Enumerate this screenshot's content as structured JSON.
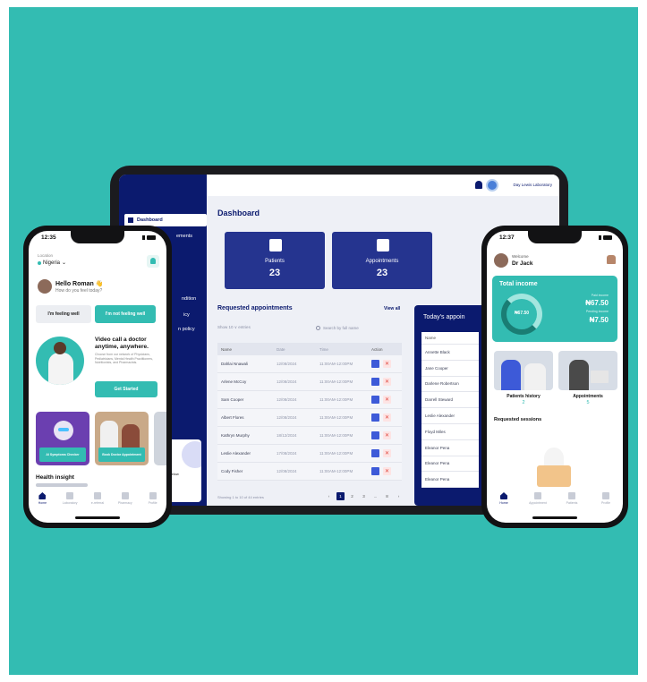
{
  "colors": {
    "background": "#33bcb2",
    "navy": "#0b1a6e",
    "teal": "#33bcb2",
    "statCard": "#25348f"
  },
  "tablet": {
    "sidebar": {
      "items": [
        {
          "label": "Dashboard",
          "icon": "grid-icon",
          "active": true
        },
        {
          "label": "ements",
          "active": false
        },
        {
          "label": "ndition",
          "active": false
        },
        {
          "label": "icy",
          "active": false
        },
        {
          "label": "n policy",
          "active": false
        }
      ],
      "promo": {
        "text": "ur fyou below",
        "button": "ill"
      }
    },
    "topbar": {
      "lab_name": "Day Lewis Laboratory"
    },
    "title": "Dashboard",
    "stats": [
      {
        "label": "Patients",
        "value": "23",
        "icon": "person-icon"
      },
      {
        "label": "Appointments",
        "value": "23",
        "icon": "calendar-icon"
      }
    ],
    "stat3_label": "To",
    "requested": {
      "title": "Requested appointments",
      "view_all": "View all",
      "show_text": "Show  10  ∨  entries",
      "search_placeholder": "Search by full name",
      "headers": [
        "Name",
        "Date",
        "Time",
        "Action"
      ],
      "rows": [
        [
          "Dahlai Nnawali",
          "12/08/2024",
          "11:00AM-12:00PM"
        ],
        [
          "Arlene McCoy",
          "12/08/2024",
          "11:00AM-12:00PM"
        ],
        [
          "Sam Cooper",
          "12/08/2024",
          "11:00AM-12:00PM"
        ],
        [
          "Albert Flores",
          "12/08/2024",
          "11:00AM-12:00PM"
        ],
        [
          "Kathryn Murphy",
          "18/12/2024",
          "11:00AM-12:00PM"
        ],
        [
          "Leslie Alexander",
          "17/08/2024",
          "11:00AM-12:00PM"
        ],
        [
          "Cody Fisher",
          "12/08/2024",
          "11:00AM-12:00PM"
        ]
      ],
      "footer": "Showing 1 to 10 of 44 entries",
      "pages": [
        "‹",
        "1",
        "2",
        "3",
        "...",
        "8",
        "›"
      ]
    },
    "today": {
      "title": "Today's appoin",
      "header": "Name",
      "names": [
        "Annette Black",
        "Jane Cooper",
        "Darlene Robertson",
        "Darrell Steward",
        "Leslie Alexander",
        "Floyd Miles",
        "Eleanor Pena",
        "Eleanor Pena",
        "Eleanor Pena"
      ]
    }
  },
  "left_phone": {
    "time": "12:35",
    "location_label": "Location",
    "location": "Nigeria",
    "greeting": "Hello Roman 👋",
    "greeting_sub": "How do you feel today?",
    "feel_well": "I'm feeling well",
    "feel_not_well": "I'm not feeling well",
    "video_title": "Video call a doctor anytime, anywhere.",
    "video_body": "Choose from our network of Physicians, Pediatricians, Mental Health Practitioners, Nutritionists, and Pharmacists.",
    "get_started": "Get Started",
    "cards": [
      {
        "caption": "AI Symptoms Checker"
      },
      {
        "caption": "Book Doctor Appointment"
      }
    ],
    "health_insight": "Health insight",
    "tabs": [
      "Home",
      "Laboratory",
      "e-referral",
      "Pharmacy",
      "Profile"
    ]
  },
  "right_phone": {
    "time": "12:37",
    "welcome": "Welcome",
    "name": "Dr Jack",
    "income": {
      "title": "Total income",
      "ring_value": "₦67.50",
      "label1": "Paid income",
      "value1": "₦67.50",
      "label2": "Pending income",
      "value2": "₦7.50"
    },
    "patients_history": {
      "label": "Patients history",
      "count": "2"
    },
    "appointments": {
      "label": "Appointments",
      "count": "5"
    },
    "requested_sessions": "Requested sessions",
    "tabs": [
      "Home",
      "Appointment",
      "Patients",
      "Profile"
    ]
  }
}
